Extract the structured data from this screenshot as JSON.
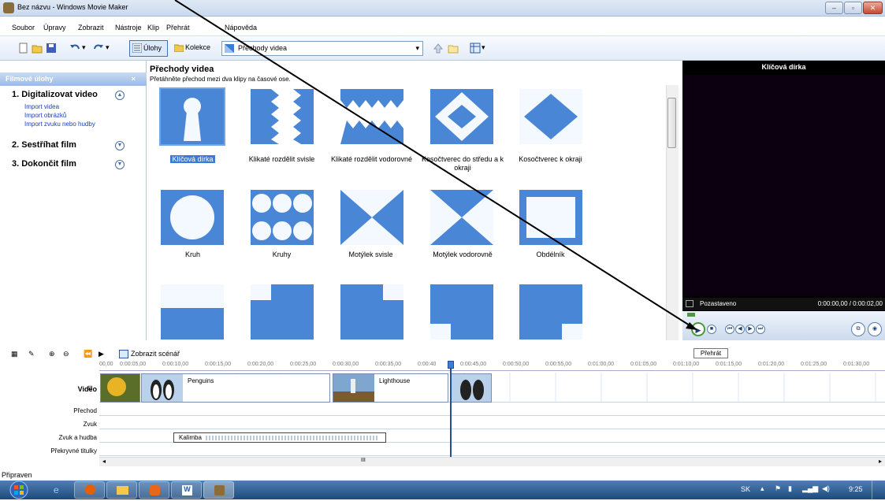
{
  "window": {
    "title": "Bez názvu - Windows Movie Maker"
  },
  "menu": [
    "Soubor",
    "Úpravy",
    "Zobrazit",
    "Nástroje",
    "Klip",
    "Přehrát",
    "Nápověda"
  ],
  "toolbar": {
    "tasks_label": "Úlohy",
    "collections_label": "Kolekce",
    "view_select": "Přechody videa"
  },
  "taskpane": {
    "header": "Filmové úlohy",
    "close": "×",
    "sections": [
      {
        "title": "1. Digitalizovat video",
        "links": [
          "Import videa",
          "Import obrázků",
          "Import zvuku nebo hudby"
        ]
      },
      {
        "title": "2. Sestříhat film",
        "links": []
      },
      {
        "title": "3. Dokončit film",
        "links": []
      }
    ]
  },
  "transitions": {
    "title": "Přechody videa",
    "subtitle": "Přetáhněte přechod mezi dva klipy na časové ose.",
    "items": [
      {
        "label": "Klíčová dírka",
        "selected": true
      },
      {
        "label": "Klikaté rozdělit svisle"
      },
      {
        "label": "Klikaté rozdělit vodorovné"
      },
      {
        "label": "Kosočtverec do středu a k okraji"
      },
      {
        "label": "Kosočtverec k okraji"
      },
      {
        "label": "Kruh"
      },
      {
        "label": "Kruhy"
      },
      {
        "label": "Motýlek svisle"
      },
      {
        "label": "Motýlek vodorovně"
      },
      {
        "label": "Obdélník"
      }
    ]
  },
  "preview": {
    "title": "Klíčová dírka",
    "status": "Pozastaveno",
    "time": "0:00:00,00 / 0:00:02,00",
    "tooltip": "Přehrát"
  },
  "timeline": {
    "storyboard_label": "Zobrazit scénář",
    "ticks": [
      "00,00",
      "0:00:05,00",
      "0:00:10,00",
      "0:00:15,00",
      "0:00:20,00",
      "0:00:25,00",
      "0:00:30,00",
      "0:00:35,00",
      "0:00:40",
      "0:00:45,00",
      "0:00:50,00",
      "0:00:55,00",
      "0:01:00,00",
      "0:01:05,00",
      "0:01:10,00",
      "0:01:15,00",
      "0:01:20,00",
      "0:01:25,00",
      "0:01:30,00"
    ],
    "tracks": [
      "Video",
      "Přechod",
      "Zvuk",
      "Zvuk a hudba",
      "Překryvné titulky"
    ],
    "clips": [
      "Penguins",
      "Lighthouse"
    ],
    "audio_clip": "Kalimba",
    "scroll_mark": "III"
  },
  "status": {
    "text": "Připraven"
  },
  "taskbar": {
    "lang": "SK",
    "clock": "9:25"
  },
  "colors": {
    "accent": "#3a7bd5",
    "thumb_blue": "#4a86d6",
    "preview_bg": "#000000"
  }
}
